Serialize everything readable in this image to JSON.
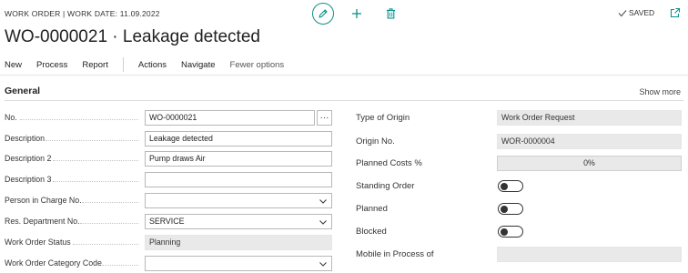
{
  "header": {
    "caption": "WORK ORDER | WORK DATE: 11.09.2022",
    "title": "WO-0000021 · Leakage detected",
    "saved_label": "SAVED"
  },
  "actions": {
    "primary": [
      "New",
      "Process",
      "Report"
    ],
    "secondary": [
      "Actions",
      "Navigate"
    ],
    "fewer": "Fewer options"
  },
  "section": {
    "title": "General",
    "show_more": "Show more"
  },
  "left_fields": [
    {
      "label": "No.",
      "value": "WO-0000021",
      "kind": "input-assist"
    },
    {
      "label": "Description",
      "value": "Leakage detected",
      "kind": "input"
    },
    {
      "label": "Description 2",
      "value": "Pump draws Air",
      "kind": "input"
    },
    {
      "label": "Description 3",
      "value": "",
      "kind": "input"
    },
    {
      "label": "Person in Charge No.",
      "value": "",
      "kind": "select"
    },
    {
      "label": "Res. Department No.",
      "value": "SERVICE",
      "kind": "select"
    },
    {
      "label": "Work Order Status",
      "value": "Planning",
      "kind": "readonly"
    },
    {
      "label": "Work Order Category Code",
      "value": "",
      "kind": "select"
    }
  ],
  "right_fields": [
    {
      "label": "Type of Origin",
      "value": "Work Order Request",
      "kind": "readonly"
    },
    {
      "label": "Origin No.",
      "value": "WOR-0000004",
      "kind": "readonly"
    },
    {
      "label": "Planned Costs %",
      "value": "0%",
      "kind": "readonly-bordered"
    },
    {
      "label": "Standing Order",
      "value": "off",
      "kind": "toggle"
    },
    {
      "label": "Planned",
      "value": "off",
      "kind": "toggle"
    },
    {
      "label": "Blocked",
      "value": "off",
      "kind": "toggle"
    },
    {
      "label": "Mobile in Process of",
      "value": "",
      "kind": "readonly"
    }
  ],
  "colors": {
    "accent": "#0e8f8a",
    "readonly_bg": "#e9e9e9"
  },
  "icons": [
    "pencil-icon",
    "plus-icon",
    "trash-icon",
    "check-icon",
    "expand-icon",
    "chevron-down-icon",
    "ellipsis-icon"
  ]
}
